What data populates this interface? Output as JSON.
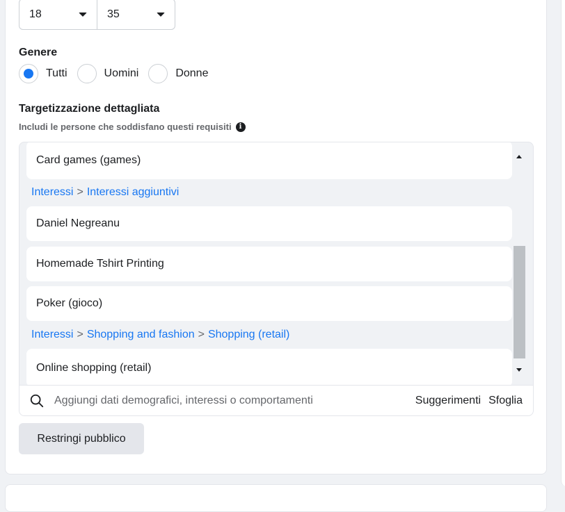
{
  "age": {
    "min": "18",
    "max": "35"
  },
  "gender": {
    "title": "Genere",
    "options": [
      {
        "label": "Tutti",
        "checked": true
      },
      {
        "label": "Uomini",
        "checked": false
      },
      {
        "label": "Donne",
        "checked": false
      }
    ]
  },
  "targeting": {
    "title": "Targetizzazione dettagliata",
    "subtitle": "Includi le persone che soddisfano questi requisiti",
    "items": [
      {
        "label": "Card games (games)"
      },
      {
        "label": "Daniel Negreanu"
      },
      {
        "label": "Homemade Tshirt Printing"
      },
      {
        "label": "Poker (gioco)"
      },
      {
        "label": "Online shopping (retail)"
      }
    ],
    "crumbs": [
      {
        "parts": [
          "Interessi",
          "Interessi aggiuntivi"
        ]
      },
      {
        "parts": [
          "Interessi",
          "Shopping and fashion",
          "Shopping (retail)"
        ]
      }
    ],
    "separator": ">",
    "search_placeholder": "Aggiungi dati demografici, interessi o comportamenti",
    "suggestions_label": "Suggerimenti",
    "browse_label": "Sfoglia"
  },
  "narrow_button_label": "Restringi pubblico",
  "colors": {
    "accent": "#1877f2",
    "scroll_thumb": "#bcc0c4",
    "button_bg": "#e4e6eb"
  }
}
